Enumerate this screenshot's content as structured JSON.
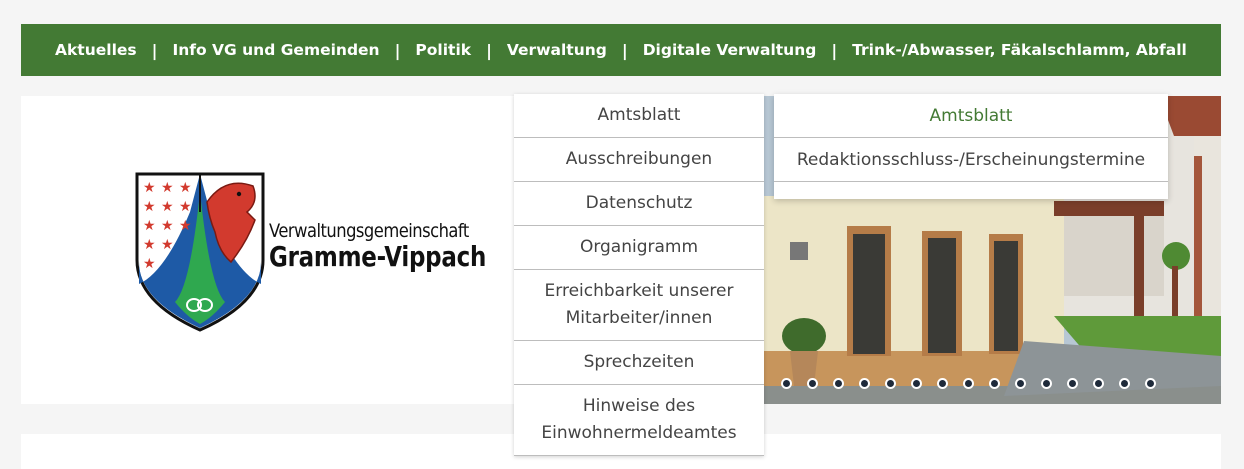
{
  "nav": {
    "items": [
      {
        "label": "Aktuelles"
      },
      {
        "label": "Info VG und Gemeinden"
      },
      {
        "label": "Politik"
      },
      {
        "label": "Verwaltung"
      },
      {
        "label": "Digitale Verwaltung"
      },
      {
        "label": "Trink-/Abwasser, Fäkalschlamm, Abfall"
      }
    ],
    "separator": "|"
  },
  "logo": {
    "line1": "Verwaltungsgemeinschaft",
    "line2": "Gramme-Vippach"
  },
  "dropdown": {
    "items": [
      {
        "label": "Amtsblatt"
      },
      {
        "label": "Ausschreibungen"
      },
      {
        "label": "Datenschutz"
      },
      {
        "label": "Organigramm"
      },
      {
        "label": "Erreichbarkeit unserer Mitarbeiter/innen"
      },
      {
        "label": "Sprechzeiten"
      },
      {
        "label": "Hinweise des Einwohnermeldeamtes"
      }
    ]
  },
  "submenu": {
    "items": [
      {
        "label": "Amtsblatt"
      },
      {
        "label": "Redaktionsschluss-/Erscheinungstermine"
      }
    ]
  },
  "slider": {
    "slide_count": 15
  },
  "colors": {
    "accent": "#437a34",
    "text": "#444444",
    "active": "#437a34"
  }
}
